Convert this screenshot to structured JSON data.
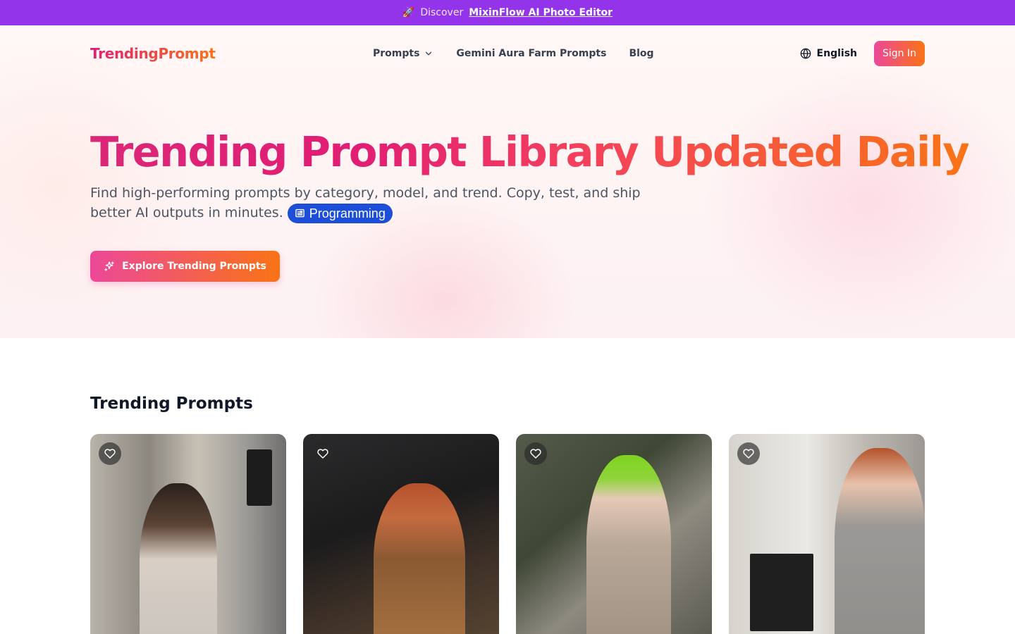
{
  "announcement": {
    "icon": "rocket-icon",
    "prefix": "Discover",
    "link_label": "MixinFlow AI Photo Editor"
  },
  "nav": {
    "logo": "TrendingPrompt",
    "links": [
      "Prompts",
      "Gemini Aura Farm Prompts",
      "Blog"
    ],
    "language": "English",
    "sign_in": "Sign In"
  },
  "hero": {
    "headline": "Trending Prompt Library Updated Daily",
    "subtitle": "Find high-performing prompts by category, model, and trend. Copy, test, and ship better AI outputs in minutes.",
    "badge": "Programming",
    "cta": "Explore Trending Prompts"
  },
  "trending": {
    "title": "Trending Prompts",
    "cards": [
      {
        "favorite_icon": "heart-icon"
      },
      {
        "favorite_icon": "heart-icon"
      },
      {
        "favorite_icon": "heart-icon"
      },
      {
        "favorite_icon": "heart-icon"
      }
    ]
  },
  "colors": {
    "announcement_bg": "#9333ea",
    "brand_gradient_start": "#ec4899",
    "brand_gradient_end": "#f97316",
    "badge_bg": "#1d4ed8"
  }
}
